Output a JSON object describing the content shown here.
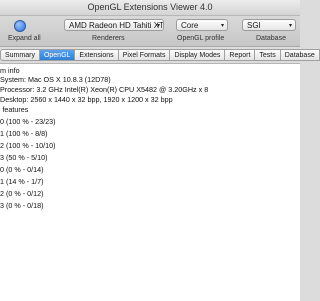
{
  "window": {
    "title": "OpenGL Extensions Viewer 4.0"
  },
  "toolbar": {
    "expand_all_label": "Expand all",
    "renderers_label": "Renderers",
    "renderer_value": "AMD Radeon HD Tahiti XT...",
    "profile_label": "OpenGL profile",
    "profile_value": "Core",
    "database_label": "Database",
    "database_value": "SGI"
  },
  "tabs": [
    "Summary",
    "OpenGL",
    "Extensions",
    "Pixel Formats",
    "Display Modes",
    "Report",
    "Tests",
    "Database"
  ],
  "content": {
    "lines": [
      "tem info",
      "System: Mac OS X 10.8.3 (12D78)",
      "Processor: 3.2 GHz Intel(R) Xeon(R) CPU         X5482  @ 3.20GHz x 8",
      "Desktop: 2560 x 1440 x 32 bpp, 1920 x 1200 x 32 bpp",
      "re features",
      "3.0 (100 % - 23/23)",
      "3.1 (100 % - 8/8)",
      "3.2 (100 % - 10/10)",
      "3.3 (50 % - 5/10)",
      "4.0 (0 % - 0/14)",
      "4.1 (14 % - 1/7)",
      "4.2 (0 % - 0/12)",
      "4.3 (0 % - 0/18)"
    ]
  }
}
